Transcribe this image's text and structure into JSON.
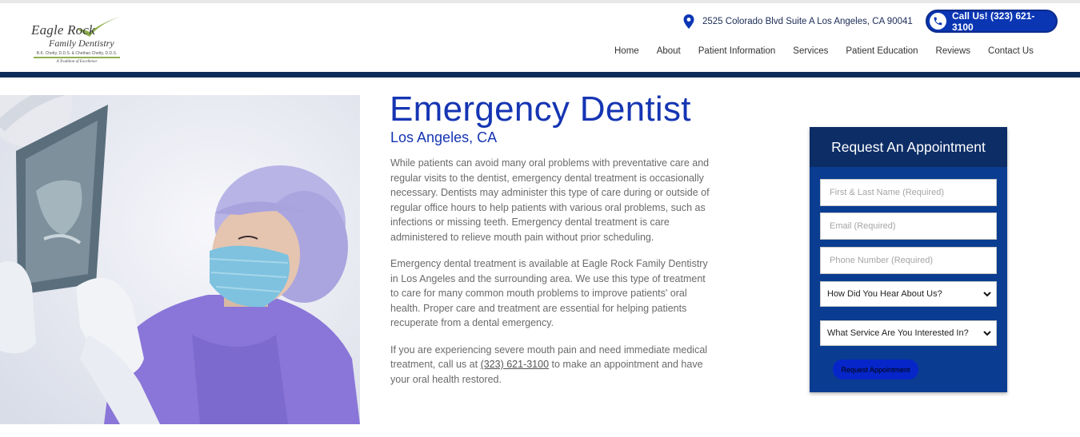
{
  "logo": {
    "line1": "Eagle Rock",
    "line2": "Family Dentistry",
    "doctors": "B.K. Chetty, D.D.S. & Chethan Chetty, D.D.S.",
    "tagline": "A Tradition of Excellence"
  },
  "header": {
    "address": "2525 Colorado Blvd Suite A Los Angeles, CA 90041",
    "call_label": "Call Us! (323) 621-3100"
  },
  "nav": [
    "Home",
    "About",
    "Patient Information",
    "Services",
    "Patient Education",
    "Reviews",
    "Contact Us"
  ],
  "main": {
    "title": "Emergency Dentist",
    "subtitle": "Los Angeles, CA",
    "p1": "While patients can avoid many oral problems with preventative care and regular visits to the dentist, emergency dental treatment is occasionally necessary. Dentists may administer this type of care during or outside of regular office hours to help patients with various oral problems, such as infections or missing teeth. Emergency dental treatment is care administered to relieve mouth pain without prior scheduling.",
    "p2": "Emergency dental treatment is available at Eagle Rock Family Dentistry in Los Angeles and the surrounding area. We use this type of treatment to care for many common mouth problems to improve patients' oral health. Proper care and treatment are essential for helping patients recuperate from a dental emergency.",
    "p3_before": "If you are experiencing severe mouth pain and need immediate medical treatment, call us at ",
    "p3_phone": "(323) 621-3100",
    "p3_after": " to make an appointment and have your oral health restored."
  },
  "form": {
    "heading": "Request An Appointment",
    "name_placeholder": "First & Last Name (Required)",
    "email_placeholder": "Email (Required)",
    "phone_placeholder": "Phone Number (Required)",
    "hear_select": "How Did You Hear About Us?",
    "service_select": "What Service Are You Interested In?",
    "submit_label": "Request Appointment"
  },
  "colors": {
    "brand_blue": "#1535b3",
    "navy": "#0d2c5a",
    "form_bg": "#0a3d91",
    "logo_green": "#8fb04d"
  }
}
